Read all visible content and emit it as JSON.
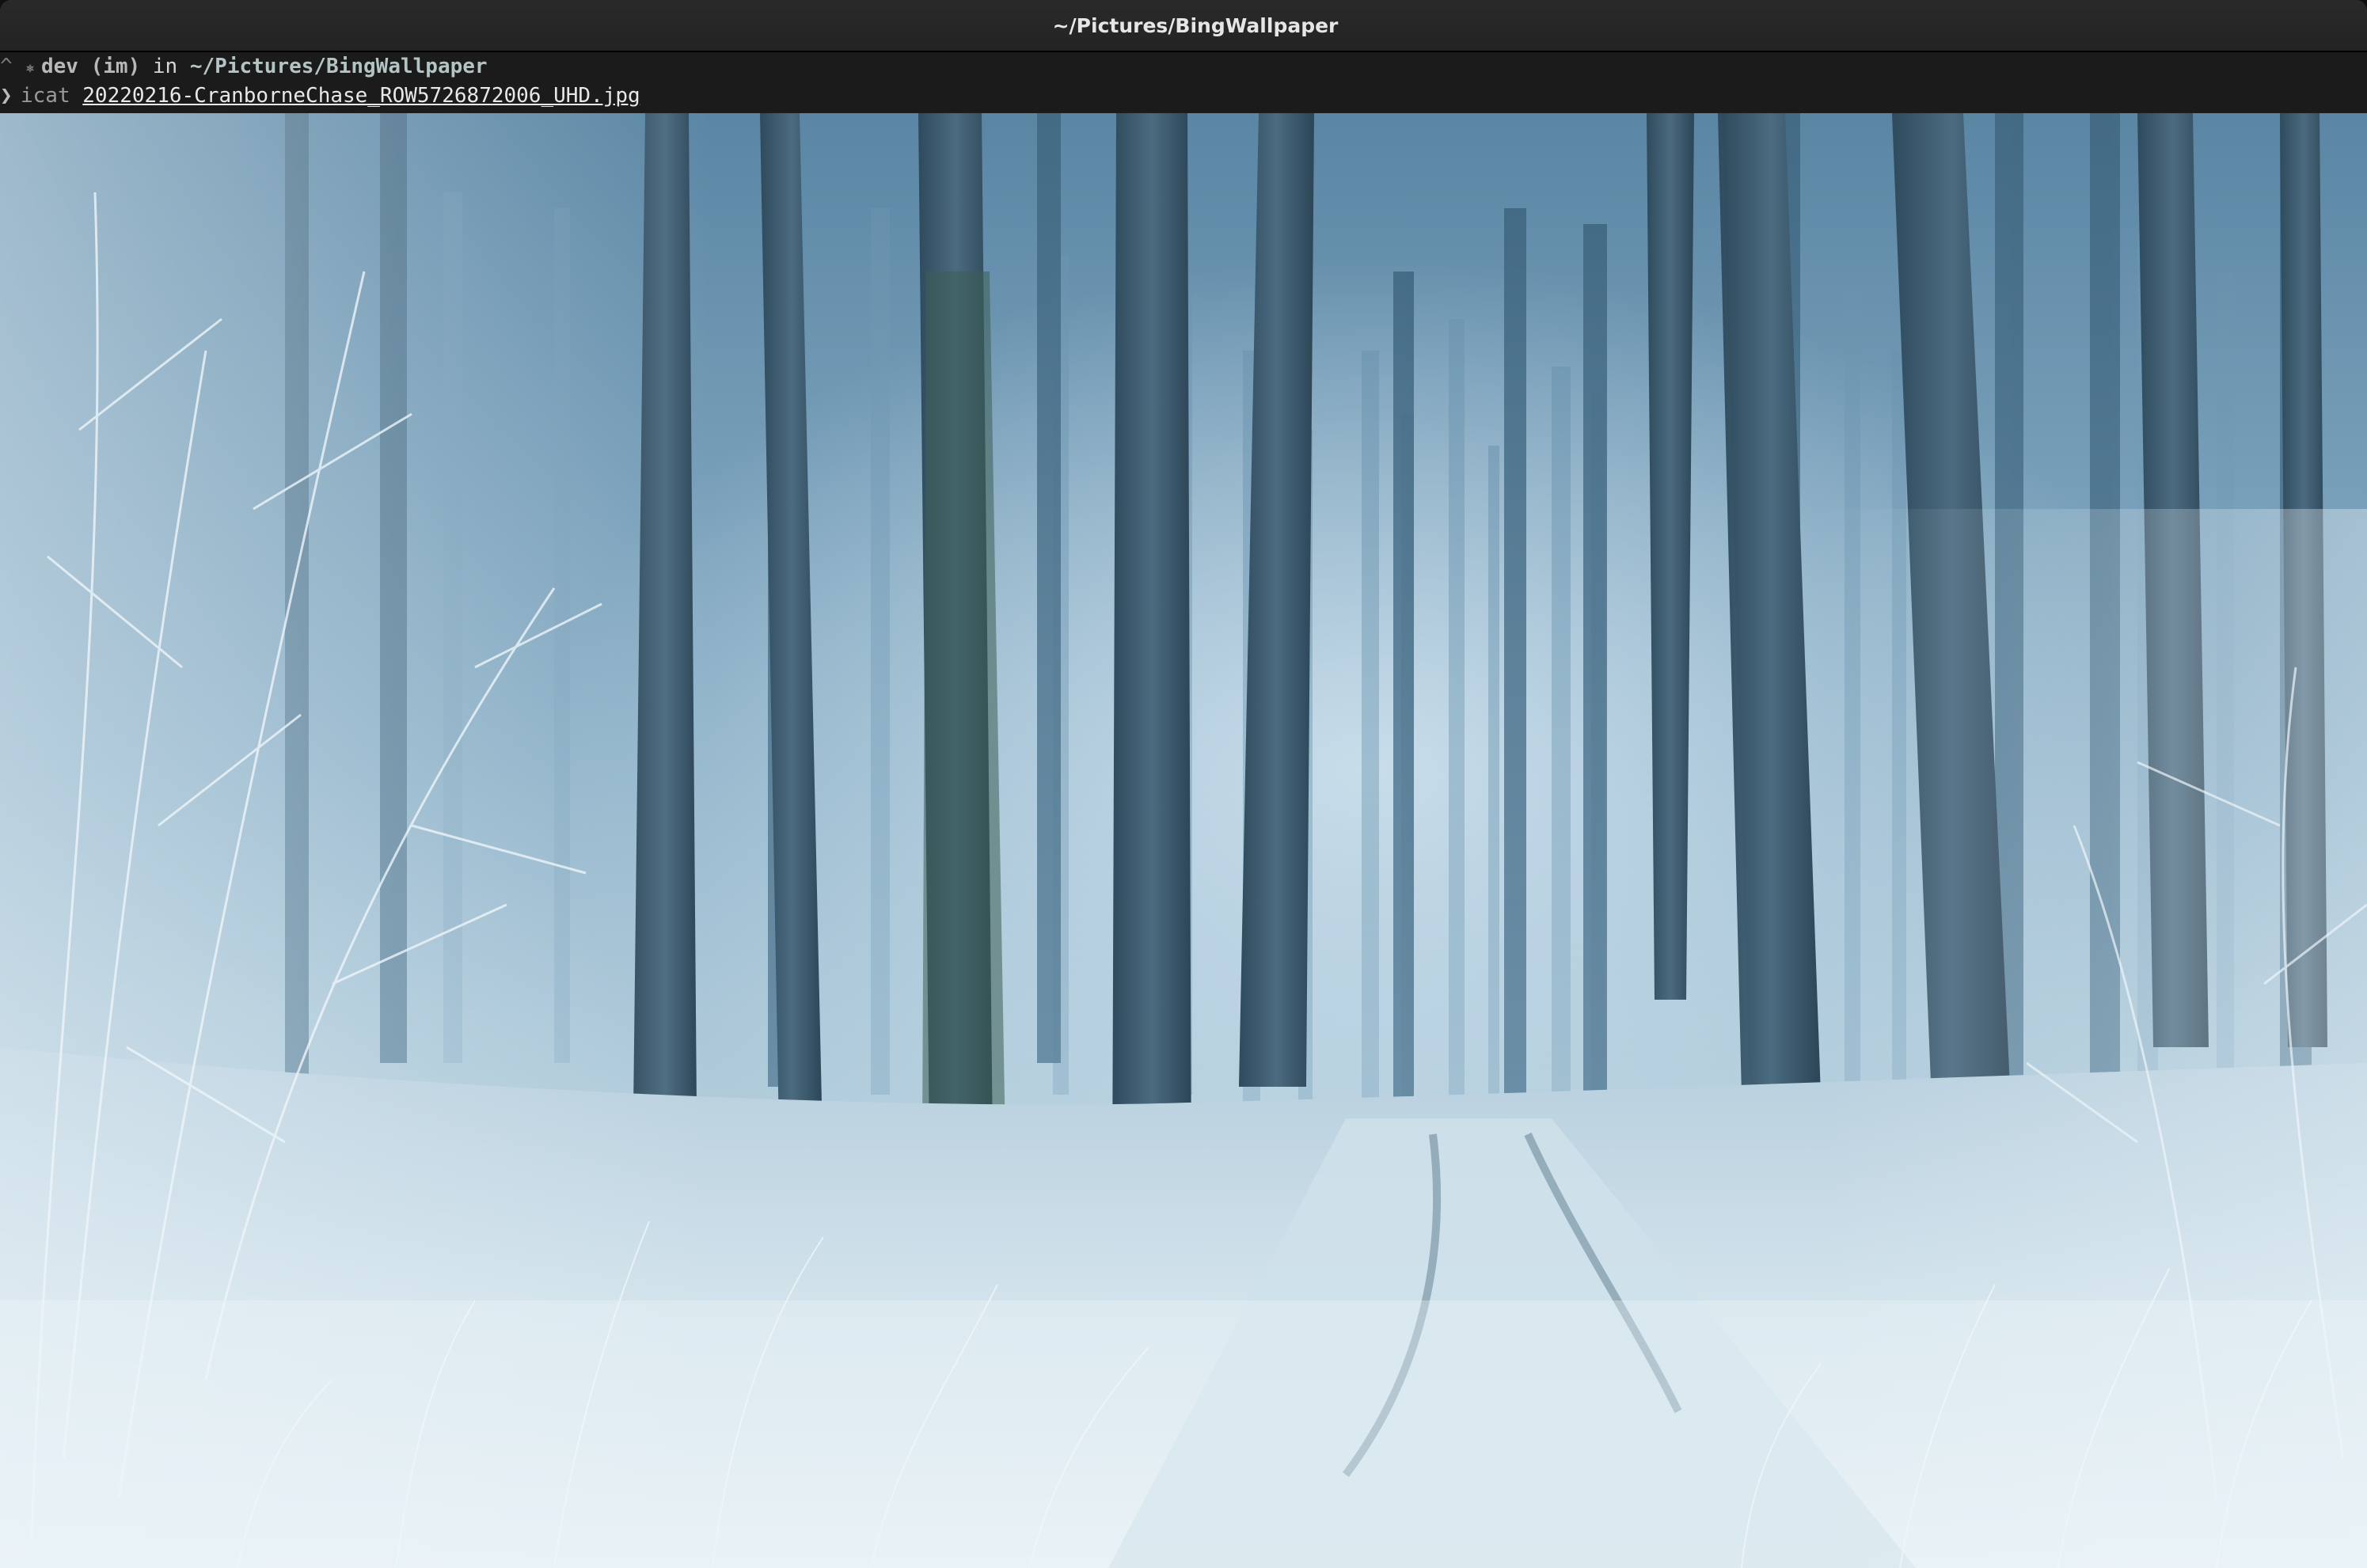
{
  "window": {
    "title": "~/Pictures/BingWallpaper"
  },
  "terminal": {
    "line1": {
      "caret": "^",
      "context_icon": "git-branch-icon",
      "branch": "dev",
      "branch_state": "(im)",
      "in_word": "in",
      "path": "~/Pictures/BingWallpaper"
    },
    "line2": {
      "prompt": "❯",
      "command": "icat",
      "argument": "20220216-CranborneChase_ROW5726872006_UHD.jpg"
    }
  },
  "image": {
    "subject": "frosty-forest-photo",
    "colors": {
      "sky_fog": "#9fbfd3",
      "deep_fog": "#5f8aa6",
      "trunk": "#3d5a70",
      "frost": "#e3eef5"
    }
  }
}
